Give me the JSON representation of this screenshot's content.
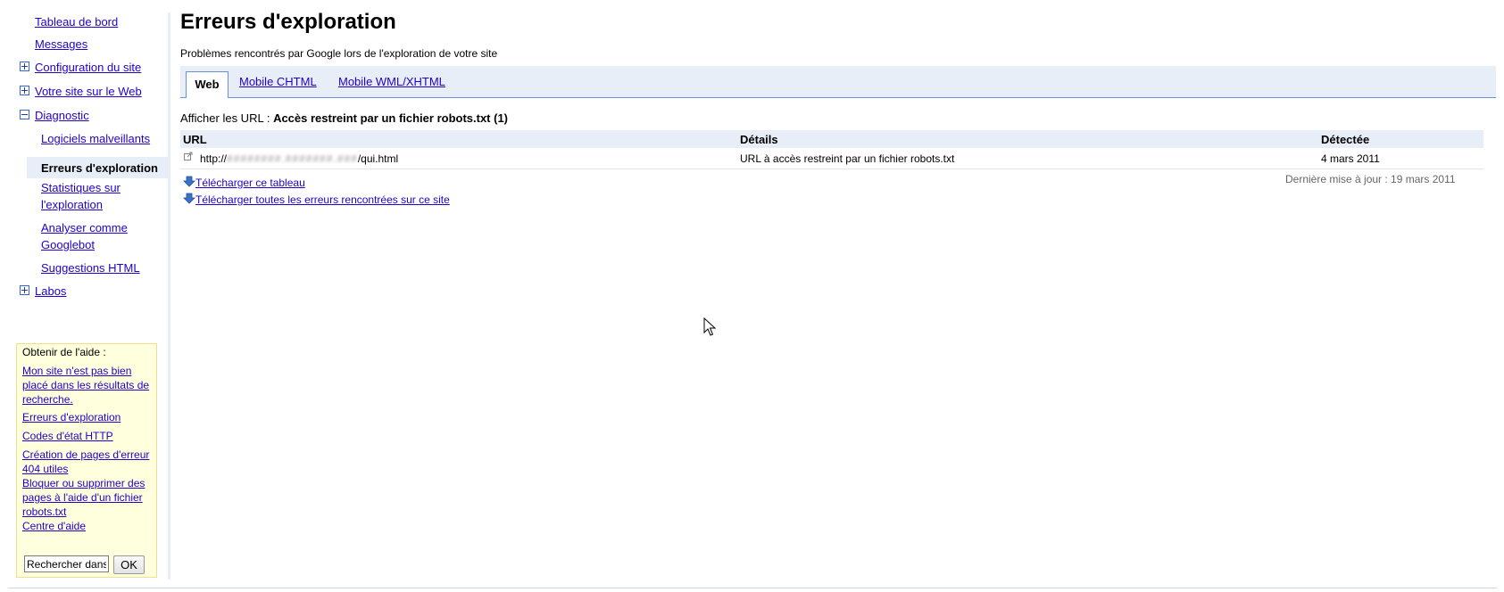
{
  "sidebar": {
    "items": [
      {
        "label": "Tableau de bord"
      },
      {
        "label": "Messages"
      },
      {
        "label": "Configuration du site"
      },
      {
        "label": "Votre site sur le Web"
      },
      {
        "label": "Diagnostic"
      },
      {
        "label": "Logiciels malveillants"
      },
      {
        "label": "Erreurs d'exploration"
      },
      {
        "label": "Statistiques sur l'exploration"
      },
      {
        "label": "Analyser comme Googlebot"
      },
      {
        "label": "Suggestions HTML"
      },
      {
        "label": "Labos"
      }
    ],
    "selected_item": "Erreurs d'exploration"
  },
  "help": {
    "title": "Obtenir de l'aide :",
    "links": [
      {
        "label": "Mon site n'est pas bien placé dans les résultats de recherche."
      },
      {
        "label": "Erreurs d'exploration"
      },
      {
        "label": "Codes d'état HTTP"
      },
      {
        "label": "Création de pages d'erreur 404 utiles"
      },
      {
        "label": "Bloquer ou supprimer des pages à l'aide d'un fichier robots.txt"
      },
      {
        "label": "Centre d'aide"
      }
    ],
    "search_value": "Rechercher dans",
    "search_button": "OK"
  },
  "main": {
    "title": "Erreurs d'exploration",
    "subtitle": "Problèmes rencontrés par Google lors de l'exploration de votre site",
    "tabs": [
      {
        "label": "Web",
        "active": true
      },
      {
        "label": "Mobile CHTML"
      },
      {
        "label": "Mobile WML/XHTML"
      }
    ],
    "filter": {
      "prefix": "Afficher les URL :",
      "value": "Accès restreint par un fichier robots.txt (1)"
    },
    "table": {
      "headers": [
        "URL",
        "Détails",
        "Détectée"
      ],
      "rows": [
        {
          "url_prefix": "http://",
          "url_obscured": "########.#######.###",
          "url_suffix": "/qui.html",
          "details": "URL à accès restreint par un fichier robots.txt",
          "detected": "4 mars 2011"
        }
      ]
    },
    "last_updated": "Dernière mise à jour : 19 mars 2011",
    "downloads": [
      {
        "label": "Télécharger ce tableau"
      },
      {
        "label": "Télécharger toutes les erreurs rencontrées sur ce site"
      }
    ]
  },
  "colors": {
    "link": "#2200cc",
    "tab_bar": "#e8eef7",
    "help_box": "#ffffdd",
    "border_blue": "#6b90da"
  },
  "icons": [
    "expand-icon",
    "collapse-icon",
    "external-link-icon",
    "download-arrow-icon",
    "mouse-cursor-icon"
  ]
}
